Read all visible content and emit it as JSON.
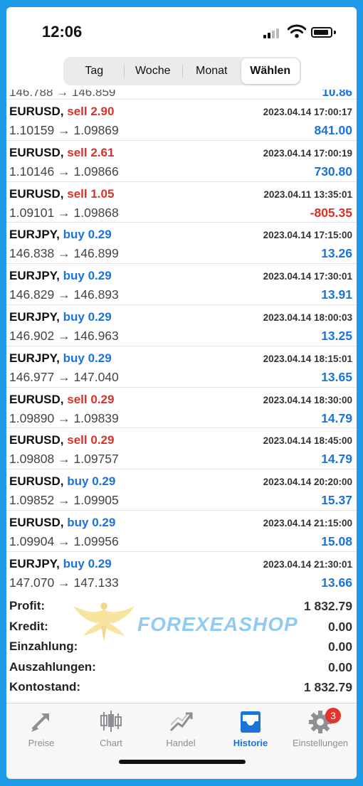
{
  "status": {
    "time": "12:06"
  },
  "segments": [
    {
      "label": "Tag",
      "active": false
    },
    {
      "label": "Woche",
      "active": false
    },
    {
      "label": "Monat",
      "active": false
    },
    {
      "label": "Wählen",
      "active": true
    }
  ],
  "partial_row": {
    "price": "146.788 → 146.859",
    "profit": "10.86"
  },
  "trades": [
    {
      "symbol": "EURUSD,",
      "side": "sell",
      "volume": "2.90",
      "time": "2023.04.14 17:00:17",
      "open": "1.10159",
      "close": "1.09869",
      "profit": "841.00",
      "negative": false
    },
    {
      "symbol": "EURUSD,",
      "side": "sell",
      "volume": "2.61",
      "time": "2023.04.14 17:00:19",
      "open": "1.10146",
      "close": "1.09866",
      "profit": "730.80",
      "negative": false
    },
    {
      "symbol": "EURUSD,",
      "side": "sell",
      "volume": "1.05",
      "time": "2023.04.11 13:35:01",
      "open": "1.09101",
      "close": "1.09868",
      "profit": "-805.35",
      "negative": true
    },
    {
      "symbol": "EURJPY,",
      "side": "buy",
      "volume": "0.29",
      "time": "2023.04.14 17:15:00",
      "open": "146.838",
      "close": "146.899",
      "profit": "13.26",
      "negative": false
    },
    {
      "symbol": "EURJPY,",
      "side": "buy",
      "volume": "0.29",
      "time": "2023.04.14 17:30:01",
      "open": "146.829",
      "close": "146.893",
      "profit": "13.91",
      "negative": false
    },
    {
      "symbol": "EURJPY,",
      "side": "buy",
      "volume": "0.29",
      "time": "2023.04.14 18:00:03",
      "open": "146.902",
      "close": "146.963",
      "profit": "13.25",
      "negative": false
    },
    {
      "symbol": "EURJPY,",
      "side": "buy",
      "volume": "0.29",
      "time": "2023.04.14 18:15:01",
      "open": "146.977",
      "close": "147.040",
      "profit": "13.65",
      "negative": false
    },
    {
      "symbol": "EURUSD,",
      "side": "sell",
      "volume": "0.29",
      "time": "2023.04.14 18:30:00",
      "open": "1.09890",
      "close": "1.09839",
      "profit": "14.79",
      "negative": false
    },
    {
      "symbol": "EURUSD,",
      "side": "sell",
      "volume": "0.29",
      "time": "2023.04.14 18:45:00",
      "open": "1.09808",
      "close": "1.09757",
      "profit": "14.79",
      "negative": false
    },
    {
      "symbol": "EURUSD,",
      "side": "buy",
      "volume": "0.29",
      "time": "2023.04.14 20:20:00",
      "open": "1.09852",
      "close": "1.09905",
      "profit": "15.37",
      "negative": false
    },
    {
      "symbol": "EURUSD,",
      "side": "buy",
      "volume": "0.29",
      "time": "2023.04.14 21:15:00",
      "open": "1.09904",
      "close": "1.09956",
      "profit": "15.08",
      "negative": false
    },
    {
      "symbol": "EURJPY,",
      "side": "buy",
      "volume": "0.29",
      "time": "2023.04.14 21:30:01",
      "open": "147.070",
      "close": "147.133",
      "profit": "13.66",
      "negative": false
    }
  ],
  "arrow": "→",
  "summary": [
    {
      "label": "Profit:",
      "value": "1 832.79"
    },
    {
      "label": "Kredit:",
      "value": "0.00"
    },
    {
      "label": "Einzahlung:",
      "value": "0.00"
    },
    {
      "label": "Auszahlungen:",
      "value": "0.00"
    },
    {
      "label": "Kontostand:",
      "value": "1 832.79"
    }
  ],
  "watermark": {
    "text": "FOREXEASHOP"
  },
  "tabs": [
    {
      "label": "Preise",
      "icon": "arrows-icon",
      "active": false
    },
    {
      "label": "Chart",
      "icon": "candles-icon",
      "active": false
    },
    {
      "label": "Handel",
      "icon": "trend-icon",
      "active": false
    },
    {
      "label": "Historie",
      "icon": "inbox-icon",
      "active": true
    },
    {
      "label": "Einstellungen",
      "icon": "gear-icon",
      "active": false,
      "badge": "3"
    }
  ],
  "colors": {
    "sell": "#d9322b",
    "buy": "#1a73d9",
    "accent": "#1a73d9",
    "frame": "#1e9be6"
  }
}
